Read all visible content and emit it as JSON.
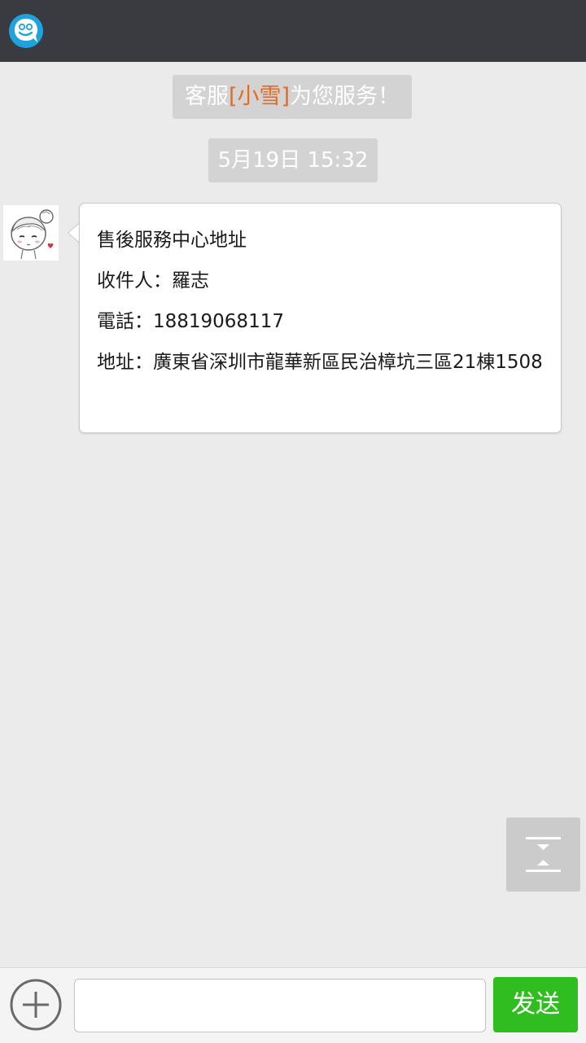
{
  "header": {
    "logo_icon": "chat-face-icon",
    "bg_color": "#393b41"
  },
  "system_notice": {
    "prefix": "客服",
    "agent_name": "[小雪]",
    "suffix": "为您服务！",
    "agent_color": "#e8691d"
  },
  "timestamp": "5月19日 15:32",
  "message": {
    "avatar_icon": "cartoon-girl-avatar",
    "lines": [
      "售後服務中心地址",
      "收件人：羅志",
      "電話：18819068117",
      "地址：廣東省深圳市龍華新區民治樟坑三區21棟1508"
    ]
  },
  "scroll_toggle_icon": "collapse-expand-icon",
  "composer": {
    "plus_icon": "plus-circle-icon",
    "input_value": "",
    "input_placeholder": "",
    "send_label": "发送",
    "send_color": "#2fbd20"
  }
}
